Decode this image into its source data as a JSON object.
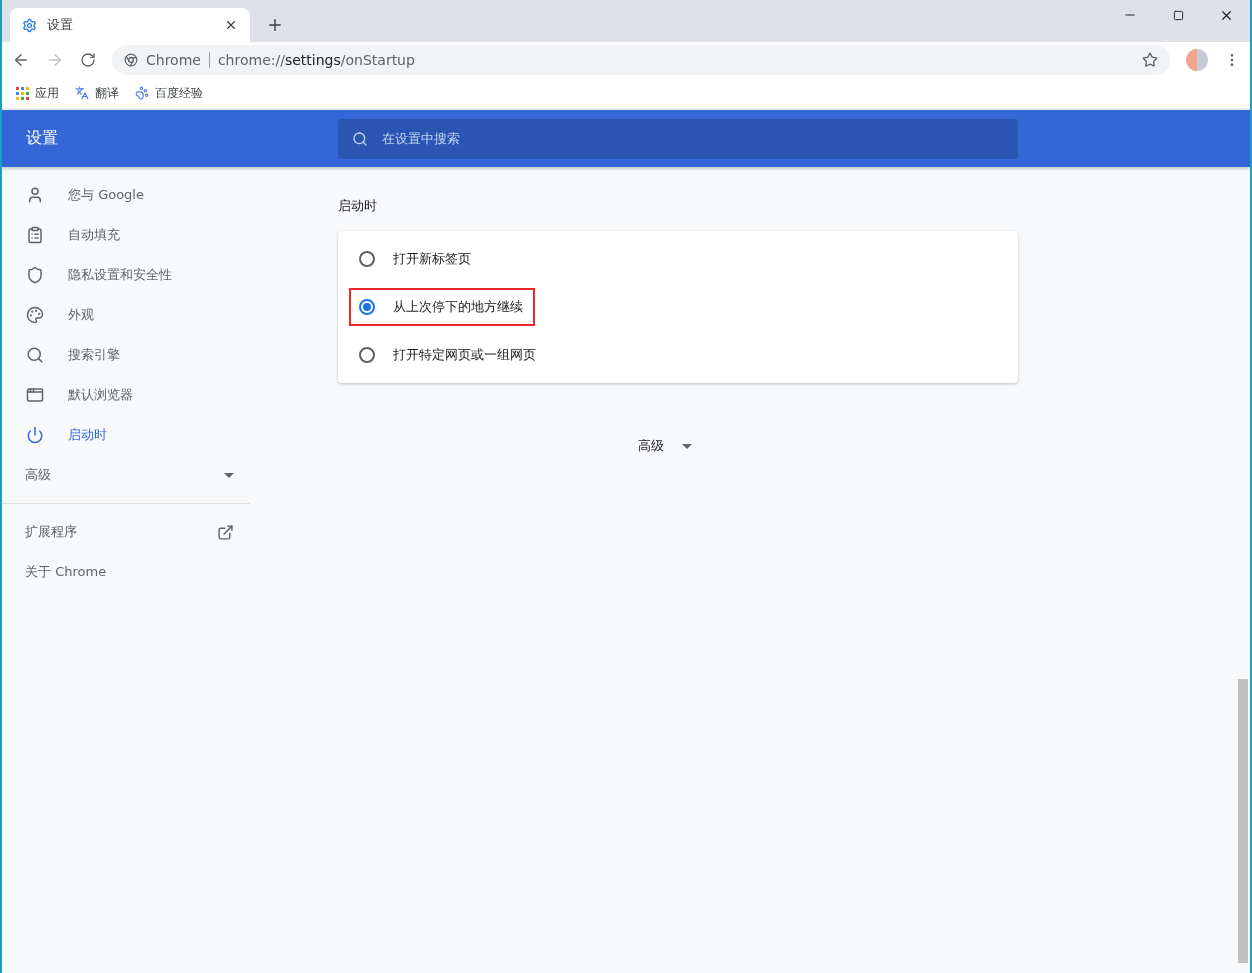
{
  "tab": {
    "title": "设置",
    "selected": true
  },
  "address_bar": {
    "site": "Chrome",
    "url_prefix": "chrome://",
    "url_path": "settings",
    "url_suffix": "/onStartup"
  },
  "bookmarks": [
    "应用",
    "翻译",
    "百度经验"
  ],
  "header": {
    "title": "设置",
    "search_placeholder": "在设置中搜索"
  },
  "sidebar": {
    "items": [
      {
        "label": "您与 Google",
        "selected": false
      },
      {
        "label": "自动填充",
        "selected": false
      },
      {
        "label": "隐私设置和安全性",
        "selected": false
      },
      {
        "label": "外观",
        "selected": false
      },
      {
        "label": "搜索引擎",
        "selected": false
      },
      {
        "label": "默认浏览器",
        "selected": false
      },
      {
        "label": "启动时",
        "selected": true
      }
    ],
    "advanced": "高级",
    "extensions": "扩展程序",
    "about": "关于 Chrome"
  },
  "section": {
    "title": "启动时",
    "options": [
      {
        "label": "打开新标签页",
        "selected": false,
        "highlighted": false
      },
      {
        "label": "从上次停下的地方继续",
        "selected": true,
        "highlighted": true
      },
      {
        "label": "打开特定网页或一组网页",
        "selected": false,
        "highlighted": false
      }
    ]
  },
  "advanced_button": "高级"
}
